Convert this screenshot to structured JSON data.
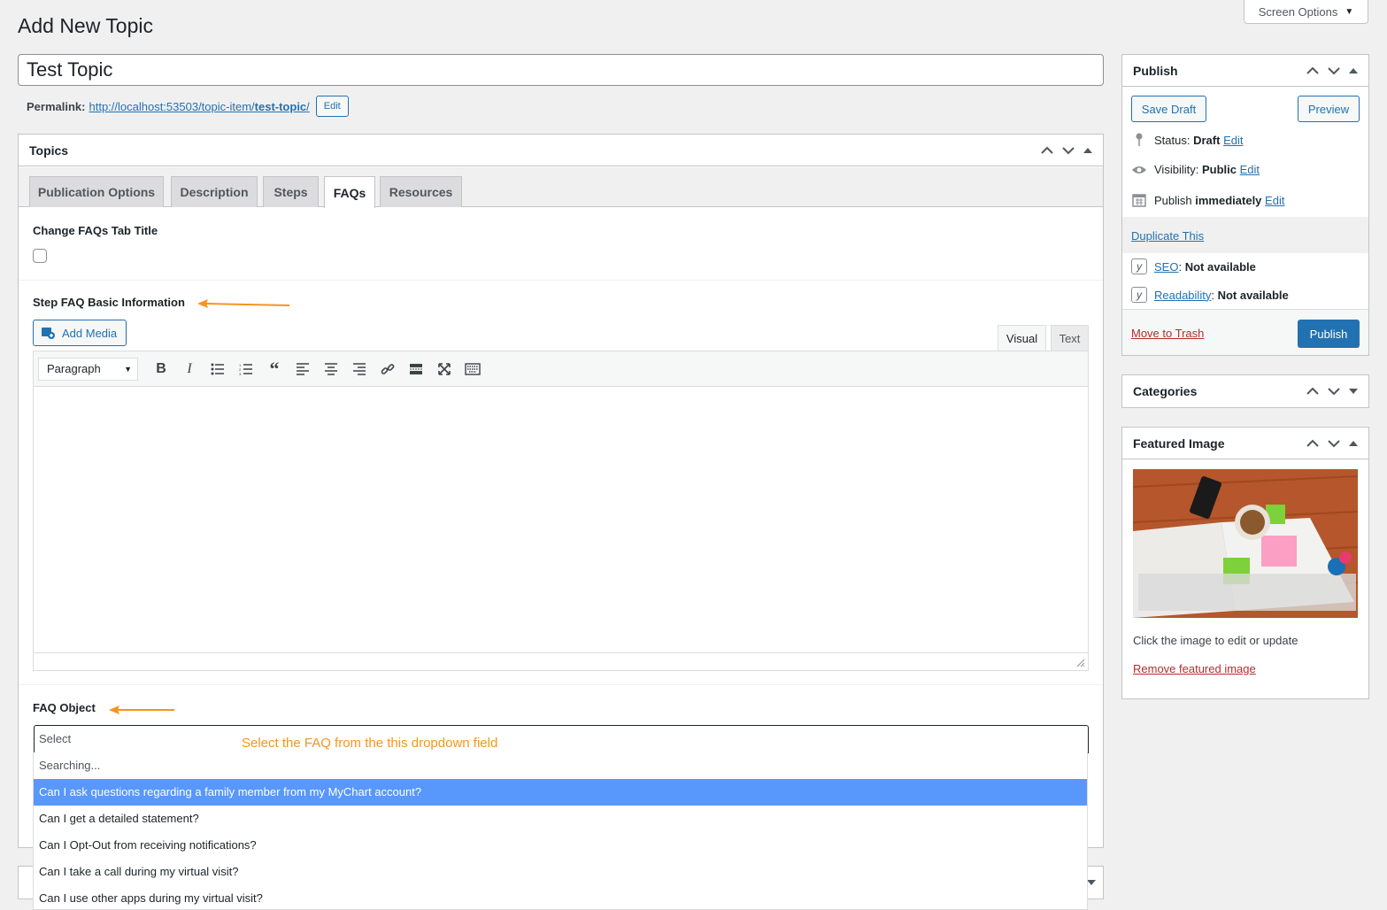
{
  "screen_options": {
    "label": "Screen Options"
  },
  "page": {
    "title": "Add New Topic"
  },
  "post": {
    "title": "Test Topic",
    "permalink_label": "Permalink:",
    "permalink_base": "http://localhost:53503/topic-item/",
    "permalink_slug": "test-topic",
    "permalink_tail": "/",
    "permalink_edit": "Edit"
  },
  "topics_box": {
    "title": "Topics",
    "tabs": [
      "Publication Options",
      "Description",
      "Steps",
      "FAQs",
      "Resources"
    ],
    "active_tab": "FAQs",
    "change_title_label": "Change FAQs Tab Title",
    "step_faq_label": "Step FAQ Basic Information",
    "add_media": "Add Media",
    "editor_tabs": {
      "visual": "Visual",
      "text": "Text"
    },
    "format": "Paragraph",
    "faq_object_label": "FAQ Object",
    "select_placeholder": "Select",
    "annotation": "Select the FAQ from the this dropdown field",
    "searching": "Searching...",
    "options": [
      "Can I ask questions regarding a family member from my MyChart account?",
      "Can I get a detailed statement?",
      "Can I Opt-Out from receiving notifications?",
      "Can I take a call during my virtual visit?",
      "Can I use other apps during my virtual visit?"
    ],
    "highlighted_index": 0
  },
  "publish_box": {
    "title": "Publish",
    "save_draft": "Save Draft",
    "preview": "Preview",
    "status_label": "Status:",
    "status_value": "Draft",
    "visibility_label": "Visibility:",
    "visibility_value": "Public",
    "publish_label": "Publish",
    "publish_value": "immediately",
    "edit": "Edit",
    "duplicate": "Duplicate This",
    "seo_link": "SEO",
    "seo_value": "Not available",
    "readability_link": "Readability",
    "readability_value": "Not available",
    "trash": "Move to Trash",
    "publish_button": "Publish"
  },
  "categories_box": {
    "title": "Categories"
  },
  "featured_box": {
    "title": "Featured Image",
    "hint": "Click the image to edit or update",
    "remove": "Remove featured image"
  },
  "colors": {
    "accent": "#2271b1",
    "highlight": "#5897fb",
    "annotation": "#f7941d",
    "danger": "#b32d2e"
  }
}
